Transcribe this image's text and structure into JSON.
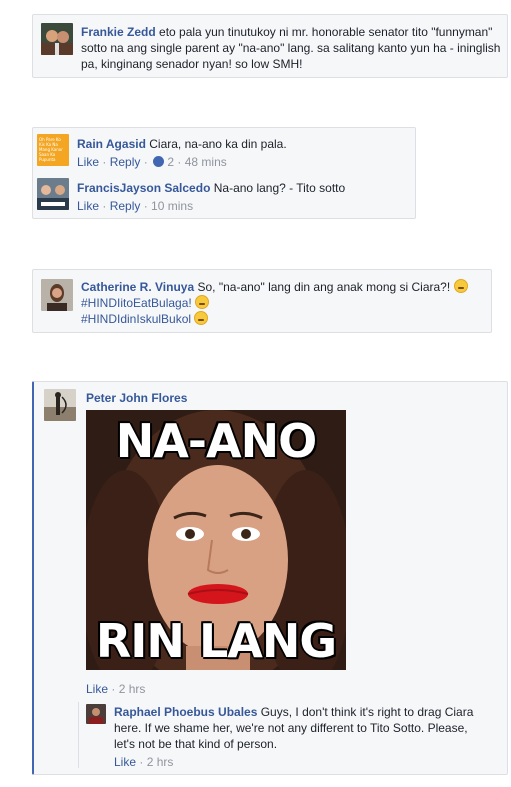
{
  "comments": [
    {
      "author": "Frankie Zedd",
      "text_line1": "eto pala yun tinutukoy ni mr. honorable senator tito \"funnyman\"",
      "text_line2": "sotto na ang single parent ay \"na-ano\" lang. sa salitang kanto yun ha - ininglish",
      "text_line3": "pa, kinginang senador nyan! so low SMH!"
    },
    {
      "author": "Rain Agasid",
      "text": "Ciara, na-ano ka din pala.",
      "like": "Like",
      "reply": "Reply",
      "reactions": "2",
      "time": "48 mins",
      "avatar_lines": [
        "Oh Pare Ko",
        "Kis Ka Na",
        "Mang Kanor",
        "Saan Ka",
        "Pupunta"
      ]
    },
    {
      "author": "FrancisJayson Salcedo",
      "text": "Na-ano lang? - Tito sotto",
      "like": "Like",
      "reply": "Reply",
      "time": "10 mins"
    },
    {
      "author": "Catherine R. Vinuya",
      "text": "So, \"na-ano\" lang din ang anak mong si Ciara?!",
      "tag1": "#HINDIitoEatBulaga!",
      "tag2": "#HINDIdinIskulBukol"
    },
    {
      "author": "Peter John Flores",
      "meme_top": "NA-ANO",
      "meme_bottom": "RIN LANG",
      "like": "Like",
      "time": "2 hrs"
    },
    {
      "author": "Raphael Phoebus Ubales",
      "text_line1": "Guys, I don't think it's right to drag Ciara",
      "text_line2": "here. If we shame her, we're not any different to Tito Sotto. Please,",
      "text_line3": "let's not be that kind of person.",
      "like": "Like",
      "time": "2 hrs"
    }
  ],
  "colors": {
    "link": "#365899",
    "meta": "#90949c",
    "card_bg": "#f6f7f9",
    "border": "#dddfe2"
  },
  "icons": {
    "reaction": "like-icon",
    "emoji_smirk": "smirk-emoji-icon",
    "emoji_angry": "angry-emoji-icon",
    "emoji_relieved": "relieved-emoji-icon"
  }
}
